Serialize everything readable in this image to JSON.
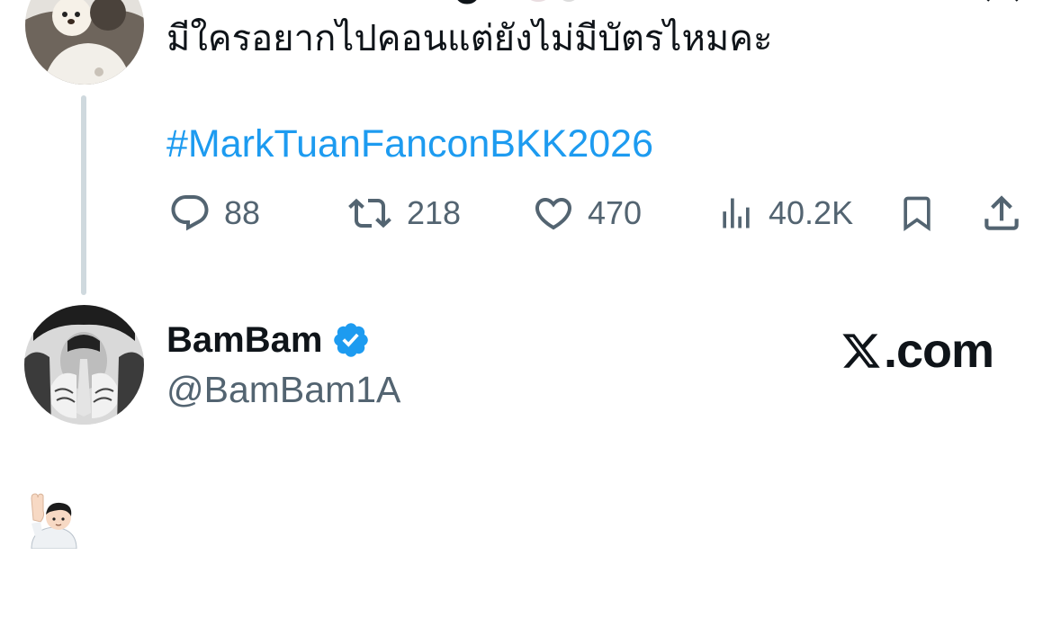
{
  "original_tweet": {
    "text": "มีใครอยากไปคอนแต่ยังไม่มีบัตรไหมคะ",
    "hashtag": "#MarkTuanFanconBKK2026",
    "stats": {
      "replies": "88",
      "retweets": "218",
      "likes": "470",
      "views": "40.2K"
    }
  },
  "reply_tweet": {
    "display_name": "BamBam",
    "handle": "@BamBam1A",
    "verified": true,
    "content_emoji": "raising-hand-person-emoji"
  },
  "brand": {
    "label": ".com"
  },
  "colors": {
    "link": "#1d9bf0",
    "muted": "#536471",
    "text": "#0f1419",
    "thread_line": "#cfd9de",
    "verified_badge": "#1d9bf0"
  }
}
